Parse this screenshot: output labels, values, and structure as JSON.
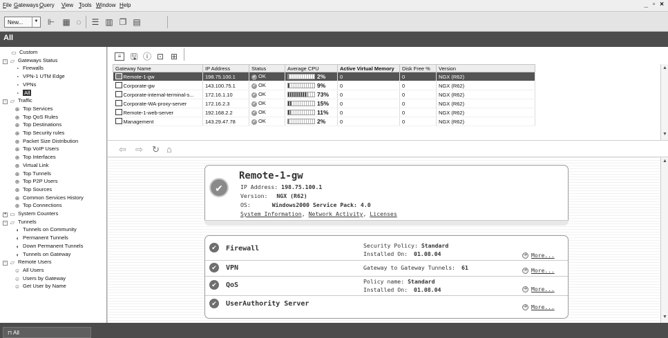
{
  "menu": [
    "File",
    "Gateways",
    "Query",
    "View",
    "Tools",
    "Window",
    "Help"
  ],
  "window_controls": "_ ▫ ×",
  "toolbar": {
    "new_label": "New..."
  },
  "title": "All",
  "tree": [
    {
      "label": "Custom",
      "icon": "folder-icon",
      "level": 1,
      "expander": false
    },
    {
      "label": "Gateways Status",
      "icon": "folder-open-icon",
      "level": 0,
      "expander": "-"
    },
    {
      "label": "Firewalls",
      "icon": "gateway-icon",
      "level": 2
    },
    {
      "label": "VPN-1 UTM Edge",
      "icon": "gateway-icon",
      "level": 2
    },
    {
      "label": "VPNs",
      "icon": "gateway-icon",
      "level": 2
    },
    {
      "label": "All",
      "icon": "gateway-icon",
      "level": 2,
      "selected": true
    },
    {
      "label": "Traffic",
      "icon": "folder-open-icon",
      "level": 0,
      "expander": "-"
    },
    {
      "label": "Top Services",
      "icon": "globe-icon",
      "level": 2
    },
    {
      "label": "Top QoS Rules",
      "icon": "globe-icon",
      "level": 2
    },
    {
      "label": "Top Destinations",
      "icon": "globe-icon",
      "level": 2
    },
    {
      "label": "Top Security rules",
      "icon": "globe-icon",
      "level": 2
    },
    {
      "label": "Packet Size Distribution",
      "icon": "globe-icon",
      "level": 2
    },
    {
      "label": "Top VoIP Users",
      "icon": "globe-icon",
      "level": 2
    },
    {
      "label": "Top Interfaces",
      "icon": "globe-icon",
      "level": 2
    },
    {
      "label": "Virtual Link",
      "icon": "globe-icon",
      "level": 2
    },
    {
      "label": "Top Tunnels",
      "icon": "globe-icon",
      "level": 2
    },
    {
      "label": "Top P2P Users",
      "icon": "globe-icon",
      "level": 2
    },
    {
      "label": "Top Sources",
      "icon": "globe-icon",
      "level": 2
    },
    {
      "label": "Common Services History",
      "icon": "globe-icon",
      "level": 2
    },
    {
      "label": "Top Connections",
      "icon": "globe-icon",
      "level": 2
    },
    {
      "label": "System Counters",
      "icon": "folder-icon",
      "level": 0,
      "expander": "+"
    },
    {
      "label": "Tunnels",
      "icon": "folder-open-icon",
      "level": 0,
      "expander": "-"
    },
    {
      "label": "Tunnels on Community",
      "icon": "tunnel-icon",
      "level": 2
    },
    {
      "label": "Permanent Tunnels",
      "icon": "tunnel-icon",
      "level": 2
    },
    {
      "label": "Down Permanent Tunnels",
      "icon": "tunnel-icon",
      "level": 2
    },
    {
      "label": "Tunnels on Gateway",
      "icon": "tunnel-icon",
      "level": 2
    },
    {
      "label": "Remote Users",
      "icon": "folder-open-icon",
      "level": 0,
      "expander": "-"
    },
    {
      "label": "All Users",
      "icon": "user-icon",
      "level": 2
    },
    {
      "label": "Users by Gateway",
      "icon": "user-icon",
      "level": 2
    },
    {
      "label": "Get User by Name",
      "icon": "user-icon",
      "level": 2
    }
  ],
  "table": {
    "columns": [
      "Gateway Name",
      "IP Address",
      "Status",
      "Average CPU",
      "Active Virtual Memory",
      "Disk Free %",
      "Version"
    ],
    "rows": [
      {
        "name": "Remote-1-gw",
        "ip": "198.75.100.1",
        "status": "OK",
        "cpu": "2%",
        "cpu_frac": 0.02,
        "mem": "0",
        "disk": "0",
        "version": "NGX (R62)",
        "selected": true
      },
      {
        "name": "Corporate-gw",
        "ip": "143.100.75.1",
        "status": "OK",
        "cpu": "9%",
        "cpu_frac": 0.09,
        "mem": "0",
        "disk": "0",
        "version": "NGX (R62)"
      },
      {
        "name": "Corporate-internal-terminal-s...",
        "ip": "172.16.1.10",
        "status": "OK",
        "cpu": "73%",
        "cpu_frac": 0.73,
        "mem": "0",
        "disk": "0",
        "version": "NGX (R62)"
      },
      {
        "name": "Corporate-WA-proxy-server",
        "ip": "172.16.2.3",
        "status": "OK",
        "cpu": "15%",
        "cpu_frac": 0.15,
        "mem": "0",
        "disk": "0",
        "version": "NGX (R62)"
      },
      {
        "name": "Remote-1-web-server",
        "ip": "192.168.2.2",
        "status": "OK",
        "cpu": "11%",
        "cpu_frac": 0.11,
        "mem": "0",
        "disk": "0",
        "version": "NGX (R62)"
      },
      {
        "name": "Management",
        "ip": "143.29.47.78",
        "status": "OK",
        "cpu": "2%",
        "cpu_frac": 0.02,
        "mem": "0",
        "disk": "0",
        "version": "NGX (R62)"
      }
    ]
  },
  "detail": {
    "title": "Remote-1-gw",
    "ip_label": "IP Address:",
    "ip": "198.75.100.1",
    "version_label": "Version:",
    "version": "NGX (R62)",
    "os_label": "OS:",
    "os": "Windows2000 Service Pack: 4.0",
    "link_sysinfo": "System Information",
    "link_net": "Network Activity",
    "link_lic": "Licenses",
    "sep": ","
  },
  "blades": [
    {
      "name": "Firewall",
      "line1_label": "Security Policy:",
      "line1_value": "Standard",
      "line2_label": "Installed On:",
      "line2_value": "01.08.04",
      "more": "More..."
    },
    {
      "name": "VPN",
      "line1_label": "Gateway to Gateway Tunnels:",
      "line1_value": "61",
      "more": "More..."
    },
    {
      "name": "QoS",
      "line1_label": "Policy name:",
      "line1_value": "Standard",
      "line2_label": "Installed On:",
      "line2_value": "01.08.04",
      "more": "More..."
    },
    {
      "name": "UserAuthority Server",
      "more": "More..."
    }
  ],
  "status_tab": "All"
}
